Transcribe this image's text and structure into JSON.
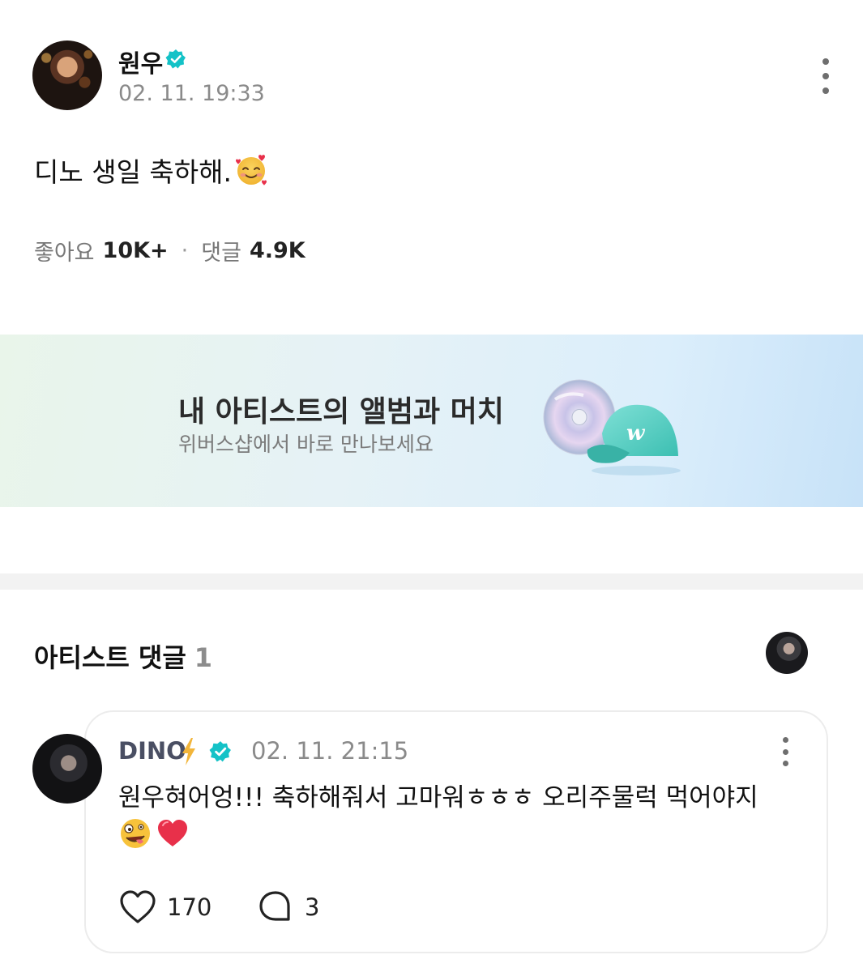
{
  "post": {
    "author": "원우",
    "time": "02. 11. 19:33",
    "text": "디노 생일 축하해.",
    "emoji": "smiling-face-with-hearts",
    "likes_label": "좋아요",
    "likes_value": "10K+",
    "separator": "·",
    "comments_label": "댓글",
    "comments_value": "4.9K"
  },
  "banner": {
    "title": "내 아티스트의 앨범과 머치",
    "subtitle": "위버스샵에서 바로 만나보세요"
  },
  "artist_comments": {
    "title": "아티스트 댓글",
    "count": "1"
  },
  "comment": {
    "author": "DINO",
    "time": "02. 11. 21:15",
    "text": "원우혀어엉!!! 축하해줘서 고마워ㅎㅎㅎ 오리주물럭 먹어야지",
    "emojis": [
      "zany-face",
      "red-heart"
    ],
    "likes": "170",
    "replies": "3"
  },
  "colors": {
    "verified": "#14c2c7",
    "text_muted": "#8a8a8a",
    "bolt": "#f2b53a",
    "heart": "#e8304a"
  }
}
